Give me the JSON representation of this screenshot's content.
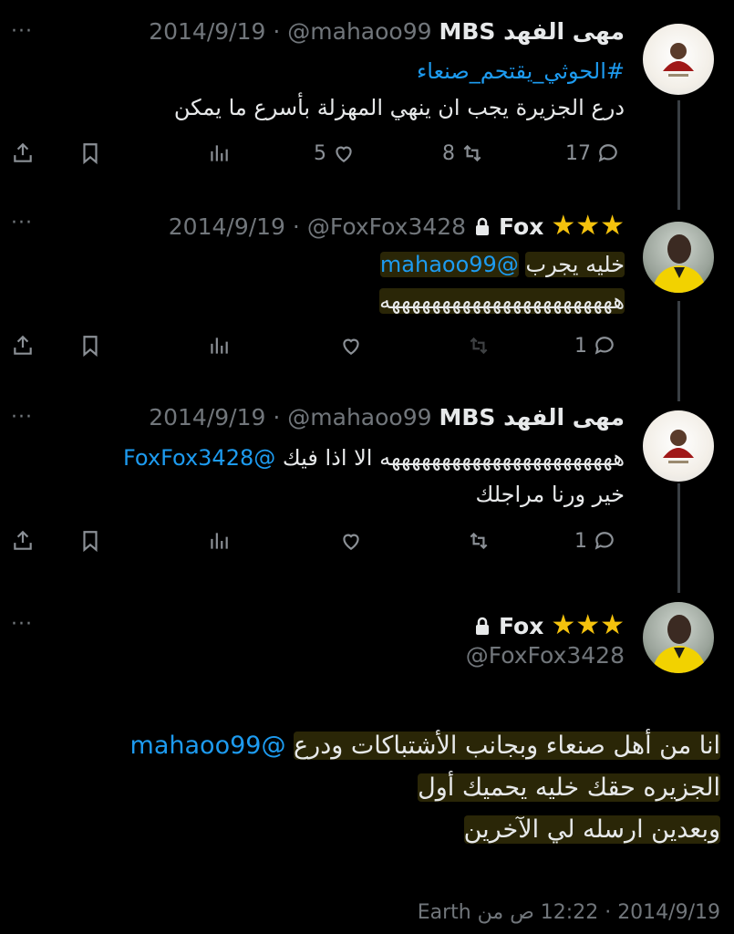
{
  "tweets": [
    {
      "name": "مهى الفهد MBS",
      "handle": "@mahaoo99",
      "date": "2014/9/19",
      "hashtag": "#الحوثي_يقتحم_صنعاء",
      "text": "درع الجزيرة يجب ان ينهي المهزلة بأسرع ما يمكن",
      "replies": "17",
      "retweets": "8",
      "likes": "5"
    },
    {
      "name": "Fox",
      "handle": "@FoxFox3428",
      "date": "2014/9/19",
      "mention": "@mahaoo99",
      "line1": "خليه يجرب",
      "line2": "هههههههههههههههههههههههه",
      "replies": "1",
      "retweets": "",
      "likes": ""
    },
    {
      "name": "مهى الفهد MBS",
      "handle": "@mahaoo99",
      "date": "2014/9/19",
      "mention": "@FoxFox3428",
      "line1": "هههههههههههههههههههههههه الا اذا فيك",
      "line2": "خير ورنا مراجلك",
      "replies": "1",
      "retweets": "",
      "likes": ""
    }
  ],
  "main_tweet": {
    "name": "Fox",
    "handle": "@FoxFox3428",
    "mention": "@mahaoo99",
    "line1": "انا من أهل صنعاء وبجانب الأشتباكات ودرع",
    "line2": "الجزيره حقك خليه يحميك أول",
    "line3": "وبعدين ارسله لي الآخرين",
    "timestamp": "2014/9/19 · 12:22 ص من Earth"
  },
  "more_label": "···",
  "sep": "·",
  "stars": "★★★",
  "colors": {
    "background": "#000000",
    "link": "#1d9bf0",
    "muted": "#71767b",
    "star": "#f4c20d"
  }
}
